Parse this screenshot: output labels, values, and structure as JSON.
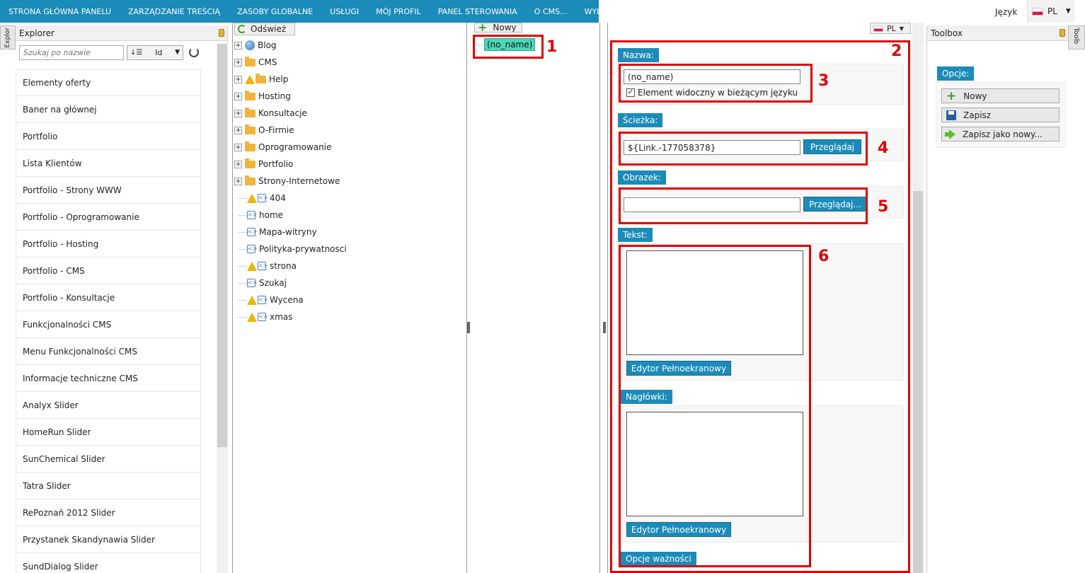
{
  "nav": {
    "items": [
      "STRONA GŁÓWNA PANELU",
      "ZARZĄDZANIE TREŚCIĄ",
      "ZASOBY GLOBALNE",
      "USŁUGI",
      "MÓJ PROFIL",
      "PANEL STEROWANIA",
      "O CMS...",
      "WYLOGUJ..."
    ],
    "language_label": "Język",
    "language_code": "PL"
  },
  "edge_tabs": {
    "left": "Explor",
    "right": "Toolb"
  },
  "explorer": {
    "title": "Explorer",
    "search_placeholder": "Szukaj po nazwie",
    "sort_value": "Id",
    "items": [
      "Elementy oferty",
      "Baner na głównej",
      "Portfolio",
      "Lista Klientów",
      "Portfolio - Strony WWW",
      "Portfolio - Oprogramowanie",
      "Portfolio - Hosting",
      "Portfolio - CMS",
      "Portfolio - Konsultacje",
      "Funkcjonalności CMS",
      "Menu Funkcjonalności CMS",
      "Informacje techniczne CMS",
      "Analyx Slider",
      "HomeRun Slider",
      "SunChemical Slider",
      "Tatra Slider",
      "RePoznań 2012 Slider",
      "Przystanek Skandynawia Slider",
      "SundDialog Slider"
    ]
  },
  "tree": {
    "refresh_label": "Odśwież",
    "nodes": [
      {
        "label": "Blog",
        "icon": "globe-icon",
        "expandable": true,
        "warning": false
      },
      {
        "label": "CMS",
        "icon": "folder-icon",
        "expandable": true,
        "warning": false
      },
      {
        "label": "Help",
        "icon": "folder-icon",
        "expandable": true,
        "warning": true
      },
      {
        "label": "Hosting",
        "icon": "folder-icon",
        "expandable": true,
        "warning": false
      },
      {
        "label": "Konsultacje",
        "icon": "folder-icon",
        "expandable": true,
        "warning": false
      },
      {
        "label": "O-Firmie",
        "icon": "folder-icon",
        "expandable": true,
        "warning": false
      },
      {
        "label": "Oprogramowanie",
        "icon": "folder-icon",
        "expandable": true,
        "warning": false
      },
      {
        "label": "Portfolio",
        "icon": "folder-icon",
        "expandable": true,
        "warning": false
      },
      {
        "label": "Strony-Internetowe",
        "icon": "folder-icon",
        "expandable": true,
        "warning": false
      },
      {
        "label": "404",
        "icon": "page-icon",
        "expandable": false,
        "warning": true
      },
      {
        "label": "home",
        "icon": "page-icon",
        "expandable": false,
        "warning": false
      },
      {
        "label": "Mapa-witryny",
        "icon": "page-icon",
        "expandable": false,
        "warning": false
      },
      {
        "label": "Polityka-prywatnosci",
        "icon": "page-icon",
        "expandable": false,
        "warning": false
      },
      {
        "label": "strona",
        "icon": "page-icon",
        "expandable": false,
        "warning": true
      },
      {
        "label": "Szukaj",
        "icon": "page-icon",
        "expandable": false,
        "warning": false
      },
      {
        "label": "Wycena",
        "icon": "page-icon",
        "expandable": false,
        "warning": true
      },
      {
        "label": "xmas",
        "icon": "page-icon",
        "expandable": false,
        "warning": true
      }
    ]
  },
  "list": {
    "new_label": "Nowy",
    "item": "(no_name)"
  },
  "form": {
    "lang_code": "PL",
    "name_label": "Nazwa:",
    "name_value": "(no_name)",
    "visible_label": "Element widoczny w bieżącym języku",
    "path_label": "Ścieżka:",
    "path_value": "${Link.-177058378}",
    "browse_label": "Przeglądaj",
    "image_label": "Obrazek:",
    "image_value": "",
    "browse_dots_label": "Przeglądaj...",
    "text_label": "Tekst:",
    "fullscreen_label": "Edytor Pełnoekranowy",
    "headers_label": "Nagłówki:",
    "fullscreen_label_2": "Edytor Pełnoekranowy",
    "validity_label": "Opcje ważności"
  },
  "annotations": [
    "1",
    "2",
    "3",
    "4",
    "5",
    "6"
  ],
  "toolbox": {
    "title": "Toolbox",
    "group_label": "Opcje:",
    "buttons": [
      "Nowy",
      "Zapisz",
      "Zapisz jako nowy..."
    ]
  },
  "colors": {
    "accent": "#1b8bb9",
    "annotation": "#e10000",
    "selection": "#4cd7b8"
  }
}
